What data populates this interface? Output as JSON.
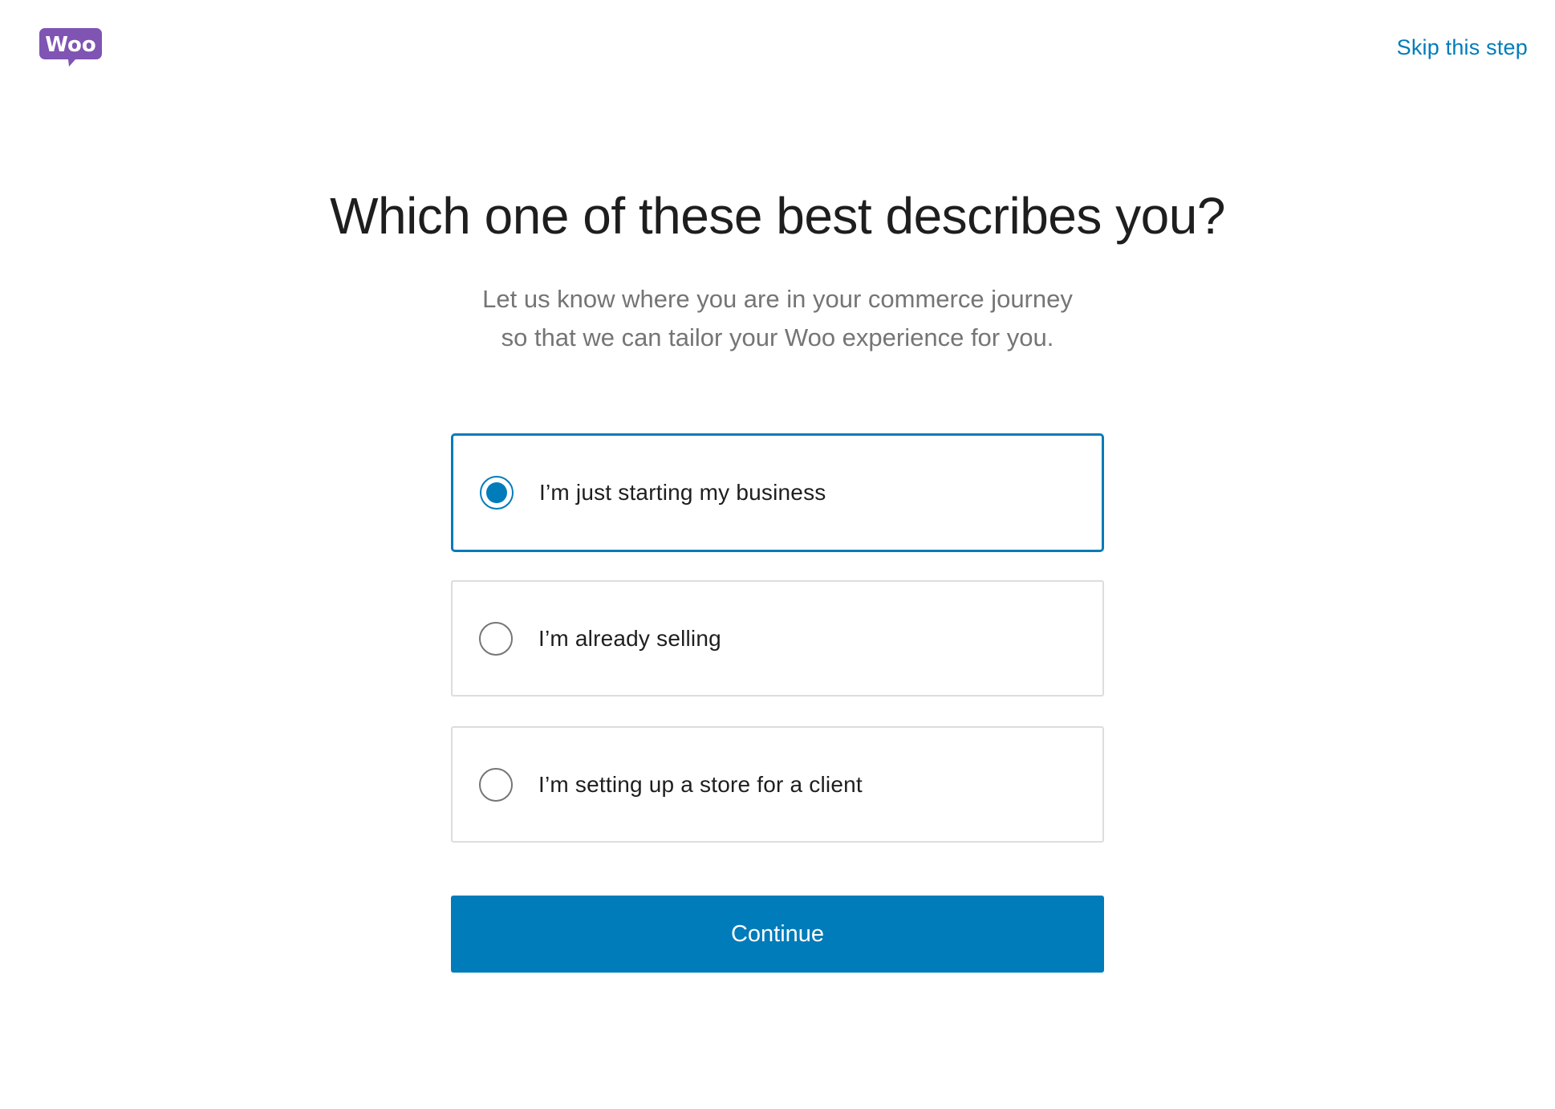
{
  "header": {
    "logo_icon": "woo-logo-icon",
    "logo_text": "Woo",
    "brand_color": "#7f54b3",
    "skip_label": "Skip this step"
  },
  "main": {
    "title": "Which one of these best describes you?",
    "subtitle_lines": [
      "Let us know where you are in your commerce journey",
      "so that we can tailor your Woo experience for you."
    ],
    "options": [
      {
        "label": "I’m just starting my business",
        "selected": true
      },
      {
        "label": "I’m already selling",
        "selected": false
      },
      {
        "label": "I’m setting up a store for a client",
        "selected": false
      }
    ],
    "continue_label": "Continue"
  },
  "colors": {
    "accent": "#007cba",
    "text": "#1e1e1e",
    "muted": "#757575"
  }
}
